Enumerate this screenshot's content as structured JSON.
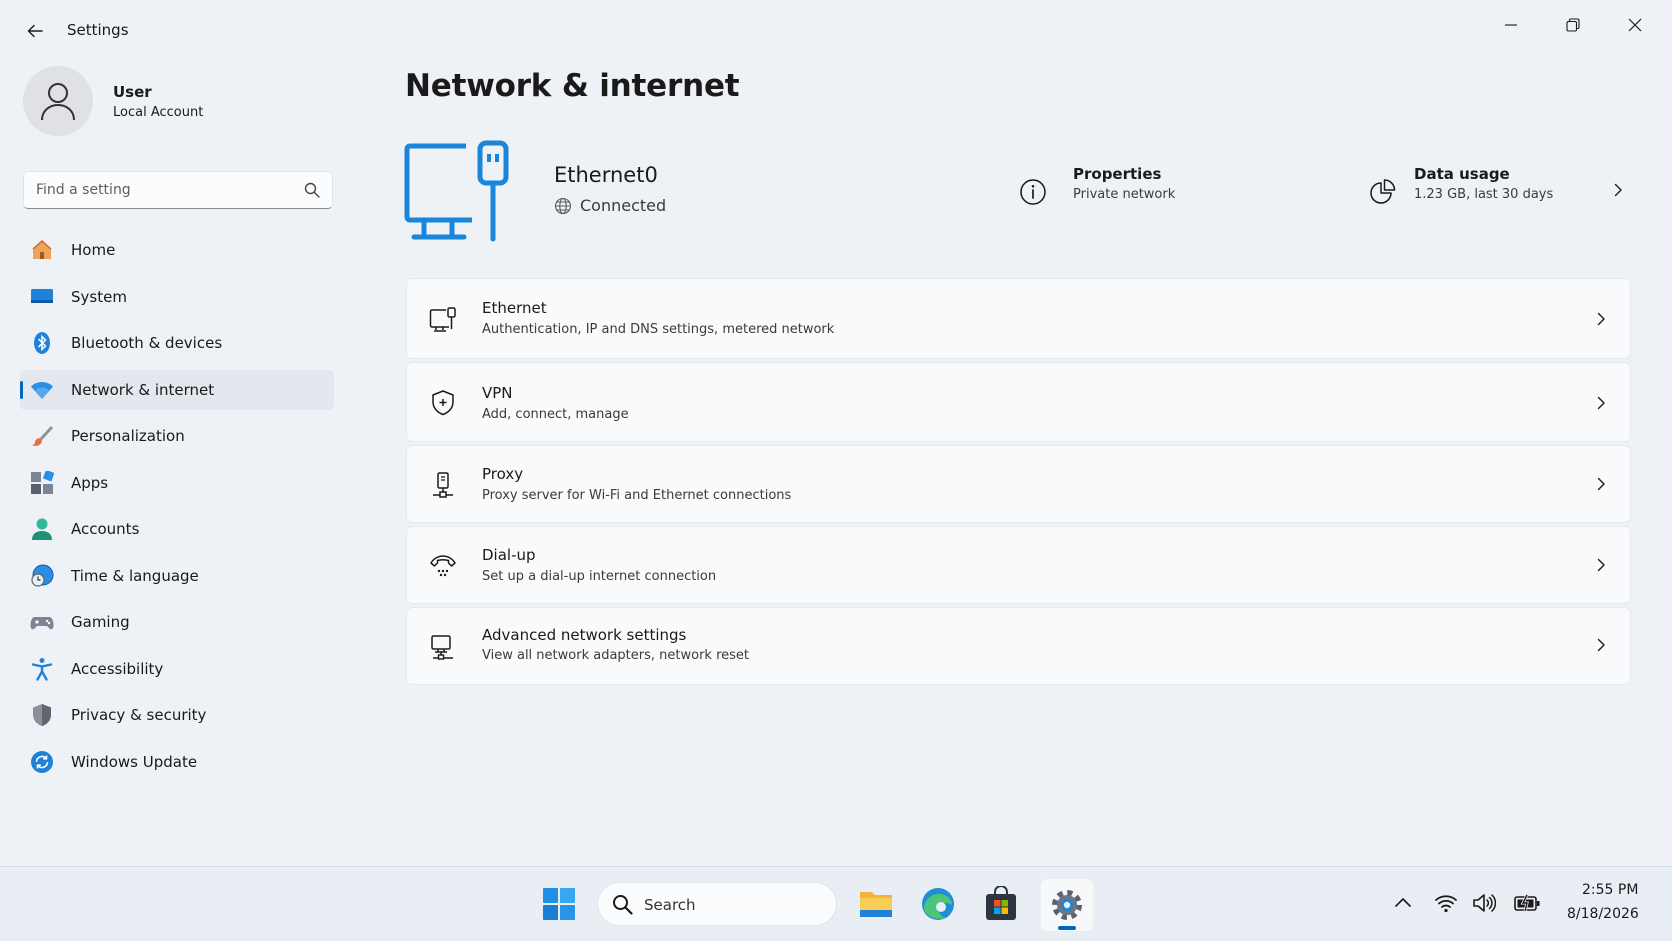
{
  "app": {
    "title": "Settings"
  },
  "user": {
    "name": "User",
    "account_type": "Local Account"
  },
  "search": {
    "placeholder": "Find a setting"
  },
  "nav": {
    "items": [
      {
        "label": "Home",
        "icon": "home-icon"
      },
      {
        "label": "System",
        "icon": "system-icon"
      },
      {
        "label": "Bluetooth & devices",
        "icon": "bluetooth-icon"
      },
      {
        "label": "Network & internet",
        "icon": "wifi-icon",
        "selected": true
      },
      {
        "label": "Personalization",
        "icon": "brush-icon"
      },
      {
        "label": "Apps",
        "icon": "apps-icon"
      },
      {
        "label": "Accounts",
        "icon": "accounts-icon"
      },
      {
        "label": "Time & language",
        "icon": "globe-clock-icon"
      },
      {
        "label": "Gaming",
        "icon": "gamepad-icon"
      },
      {
        "label": "Accessibility",
        "icon": "accessibility-icon"
      },
      {
        "label": "Privacy & security",
        "icon": "shield-icon"
      },
      {
        "label": "Windows Update",
        "icon": "update-icon"
      }
    ]
  },
  "page": {
    "title": "Network & internet"
  },
  "connection": {
    "name": "Ethernet0",
    "status": "Connected",
    "properties": {
      "title": "Properties",
      "subtitle": "Private network"
    },
    "data_usage": {
      "title": "Data usage",
      "subtitle": "1.23 GB, last 30 days"
    }
  },
  "cards": [
    {
      "title": "Ethernet",
      "subtitle": "Authentication, IP and DNS settings, metered network",
      "icon": "ethernet-icon"
    },
    {
      "title": "VPN",
      "subtitle": "Add, connect, manage",
      "icon": "vpn-shield-icon"
    },
    {
      "title": "Proxy",
      "subtitle": "Proxy server for Wi-Fi and Ethernet connections",
      "icon": "proxy-icon"
    },
    {
      "title": "Dial-up",
      "subtitle": "Set up a dial-up internet connection",
      "icon": "dialup-icon"
    },
    {
      "title": "Advanced network settings",
      "subtitle": "View all network adapters, network reset",
      "icon": "advanced-network-icon"
    }
  ],
  "taskbar": {
    "search_label": "Search",
    "time": "2:55 PM",
    "date": "8/18/2026"
  },
  "colors": {
    "accent": "#0067c0",
    "hero": "#1a86d9"
  }
}
